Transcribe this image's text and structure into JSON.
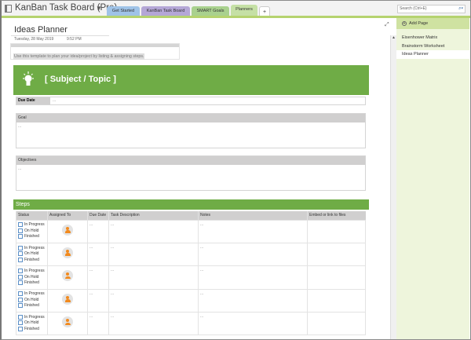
{
  "notebook": {
    "title": "KanBan Task Board (Pro)",
    "tabs": [
      {
        "label": "Get Started",
        "color": "#9fc3e7"
      },
      {
        "label": "KanBan Task Board",
        "color": "#b4a7d6"
      },
      {
        "label": "SMART Goals",
        "color": "#a9d18e"
      },
      {
        "label": "Planners",
        "color": "#c5e0a5"
      },
      {
        "label": "+",
        "color": "#ffffff"
      }
    ],
    "search_placeholder": "Search (Ctrl+E)"
  },
  "page": {
    "title": "Ideas Planner",
    "date": "Tuesday, 28 May 2019",
    "time": "9:52 PM",
    "instruction": "Use this template to plan your idea/project by listing & assigning steps.",
    "subject": "[ Subject / Topic ]",
    "due_label": "Due Date",
    "due_value": "...",
    "goal_label": "Goal",
    "goal_value": "...",
    "objectives_label": "Objectives",
    "objectives_value": "...",
    "steps_label": "Steps",
    "columns": [
      "Status",
      "Assigned To",
      "Due Date",
      "Task Description",
      "Notes",
      "Embed or link to files"
    ],
    "status_options": [
      "In Progress",
      "On Hold",
      "Finished"
    ],
    "rows": [
      {
        "due": "...",
        "task": "...",
        "notes": "...",
        "embed": ""
      },
      {
        "due": "...",
        "task": "...",
        "notes": "...",
        "embed": ""
      },
      {
        "due": "...",
        "task": "...",
        "notes": "...",
        "embed": ""
      },
      {
        "due": "...",
        "task": "...",
        "notes": "...",
        "embed": ""
      },
      {
        "due": "...",
        "task": "...",
        "notes": "...",
        "embed": ""
      }
    ]
  },
  "sidebar": {
    "add_page": "Add Page",
    "pages": [
      "Eisenhower Matrix",
      "Brainstorm Worksheet",
      "Ideas Planner"
    ],
    "selected": "Ideas Planner"
  },
  "colors": {
    "accent_green": "#6fac46",
    "avatar_orange": "#f28a1e"
  }
}
